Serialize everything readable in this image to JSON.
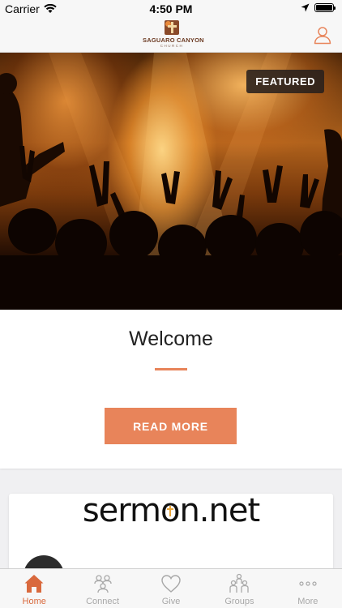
{
  "status_bar": {
    "carrier": "Carrier",
    "time": "4:50 PM",
    "battery_level": 1.0
  },
  "header": {
    "logo_title": "SAGUARO CANYON",
    "logo_subtitle": "CHURCH",
    "profile_icon": "user-icon"
  },
  "hero": {
    "badge": "FEATURED"
  },
  "featured_card": {
    "title": "Welcome",
    "button_label": "READ MORE"
  },
  "sermon_card": {
    "logo_prefix": "serm",
    "logo_o": "o",
    "logo_suffix": "n.net"
  },
  "tabs": [
    {
      "label": "Home",
      "icon": "home-icon",
      "active": true
    },
    {
      "label": "Connect",
      "icon": "connect-icon",
      "active": false
    },
    {
      "label": "Give",
      "icon": "heart-icon",
      "active": false
    },
    {
      "label": "Groups",
      "icon": "groups-icon",
      "active": false
    },
    {
      "label": "More",
      "icon": "more-icon",
      "active": false
    }
  ],
  "colors": {
    "accent": "#e8845a",
    "active_tab": "#d9693d",
    "inactive_tab": "#a8a8a8"
  }
}
